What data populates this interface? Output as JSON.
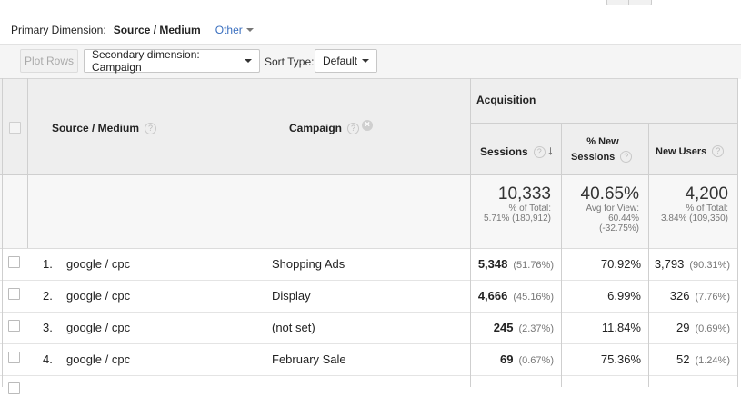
{
  "primary_dimension": {
    "label": "Primary Dimension:",
    "active": "Source / Medium",
    "other": "Other"
  },
  "toolbar": {
    "plot_rows": "Plot Rows",
    "secondary_dimension": "Secondary dimension: Campaign",
    "sort_type_label": "Sort Type:",
    "sort_type_value": "Default"
  },
  "table": {
    "columns": {
      "source_medium": "Source / Medium",
      "campaign": "Campaign",
      "group": "Acquisition",
      "sessions": "Sessions",
      "new_sessions_line1": "% New",
      "new_sessions_line2": "Sessions",
      "new_users": "New Users"
    },
    "totals": {
      "sessions": {
        "value": "10,333",
        "line1": "% of Total:",
        "line2": "5.71% (180,912)"
      },
      "new_sessions": {
        "value": "40.65%",
        "line1": "Avg for View:",
        "line2": "60.44%",
        "line3": "(-32.75%)"
      },
      "new_users": {
        "value": "4,200",
        "line1": "% of Total:",
        "line2": "3.84% (109,350)"
      }
    },
    "rows": [
      {
        "index": "1.",
        "source": "google / cpc",
        "campaign": "Shopping Ads",
        "sessions": "5,348",
        "sessions_pct": "(51.76%)",
        "new_sessions": "70.92%",
        "new_users": "3,793",
        "new_users_pct": "(90.31%)"
      },
      {
        "index": "2.",
        "source": "google / cpc",
        "campaign": "Display",
        "sessions": "4,666",
        "sessions_pct": "(45.16%)",
        "new_sessions": "6.99%",
        "new_users": "326",
        "new_users_pct": "(7.76%)"
      },
      {
        "index": "3.",
        "source": "google / cpc",
        "campaign": "(not set)",
        "sessions": "245",
        "sessions_pct": "(2.37%)",
        "new_sessions": "11.84%",
        "new_users": "29",
        "new_users_pct": "(0.69%)"
      },
      {
        "index": "4.",
        "source": "google / cpc",
        "campaign": "February Sale",
        "sessions": "69",
        "sessions_pct": "(0.67%)",
        "new_sessions": "75.36%",
        "new_users": "52",
        "new_users_pct": "(1.24%)"
      }
    ]
  },
  "icons": {
    "help": "?",
    "remove": "×",
    "sort_desc": "↓"
  }
}
